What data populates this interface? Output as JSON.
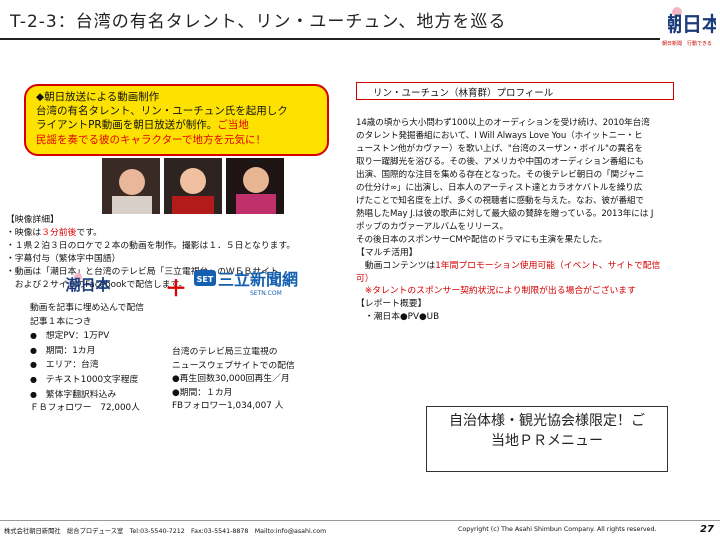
{
  "header": {
    "title": "T-2-3：台湾の有名タレント、リン・ユーチュン、地方を巡る",
    "logo_text": "潮日本",
    "logo_tagline": "朝日新聞　行動できる"
  },
  "intro_box": {
    "line1": "◆朝日放送による動画制作",
    "line2": "台湾の有名タレント、リン・ユーチュン氏を起用しク",
    "line3_prefix": "ライアントPR動画を朝日放送が制作。",
    "line3_highlight": "ご当地",
    "line4_highlight": "民謡を奏でる彼のキャラクターで地方を元気に！"
  },
  "details": {
    "heading": "【映像詳細】",
    "line1_prefix": "・映像は",
    "line1_highlight": "３分前後",
    "line1_suffix": "です。",
    "line2": "・１県２泊３日のロケで２本の動画を制作。撮影は１．５日となります。",
    "line3": "・字幕付与（繁体字中国語）",
    "line4": "・動画は「潮日本」と台湾のテレビ局「三立電視台」のＷＥＢサイト",
    "line5": "　および２サイトのFacebookで配信します。"
  },
  "logos": {
    "left_logo": "潮日本",
    "plus": "＋",
    "right_logo_badge": "SET",
    "right_logo_name": "三立新聞網",
    "right_logo_url": "SETN.COM"
  },
  "promo_left": {
    "line1": "動画を記事に埋め込んで配信",
    "line2": "記事１本につき",
    "items": [
      "想定PV：1万PV",
      "期間：1カ月",
      "エリア：台湾",
      "テキスト1000文字程度",
      "繁体字翻訳料込み"
    ],
    "footer": "ＦＢフォロワー　72,000人"
  },
  "promo_right": {
    "line1": "台湾のテレビ局三立電視の",
    "line2": "ニュースウェブサイトでの配信",
    "line3": "●再生回数30,000回再生／月",
    "line4": "●期間：１カ月",
    "line5": "FBフォロワー1,034,007 人"
  },
  "profile": {
    "header": "リン・ユーチュン（林育群）プロフィール",
    "body": [
      "14歳の頃から大小問わず100以上のオーディションを受け続け、2010年台湾",
      "のタレント発掘番組において、I Will Always Love You（ホイットニー・ヒ",
      "ューストン他がカヴァー）を歌い上げ、\"台湾のスーザン・ボイル\"の異名を",
      "取り一躍脚光を浴びる。その後、アメリカや中国のオーディション番組にも",
      "出演、国際的な注目を集める存在となった。その後テレビ朝日の「関ジャニ",
      "の仕分け∞」に出演し、日本人のアーティスト達とカラオケバトルを繰り広",
      "げたことで知名度を上げ、多くの視聴者に感動を与えた。なお、彼が番組で",
      "熱唱したMay J.は彼の歌声に対して最大級の賛辞を贈っている。2013年には J",
      "ポップのカヴァーアルバムをリリース。",
      "その後日本のスポンサーCMや配信のドラマにも主演を果たした。"
    ]
  },
  "multi_use": {
    "heading": "【マルチ活用】",
    "line1_prefix": "　動画コンテンツは",
    "line1_highlight": "1年間プロモーション使用可能（イベント、サイトで配信",
    "line2_highlight": "可）",
    "line3_highlight": "　※タレントのスポンサー契約状況により制限が出る場合がございます",
    "report_heading": "【レポート概要】",
    "report_line": "　・潮日本●PV●UB"
  },
  "cta": {
    "line1": "自治体様・観光協会様限定！ご",
    "line2": "当地ＰＲメニュー"
  },
  "footer": {
    "left": "株式会社朝日新聞社　総合プロデュース室　Tel:03-5540-7212　Fax:03-5541-8878　Mailto:info@asahi.com",
    "right": "Copyright (c) The Asahi Shimbun Company. All rights reserved.",
    "page_number": "27"
  },
  "colors": {
    "accent_red": "#d40000",
    "highlight_yellow": "#fde200",
    "text": "#111111"
  }
}
